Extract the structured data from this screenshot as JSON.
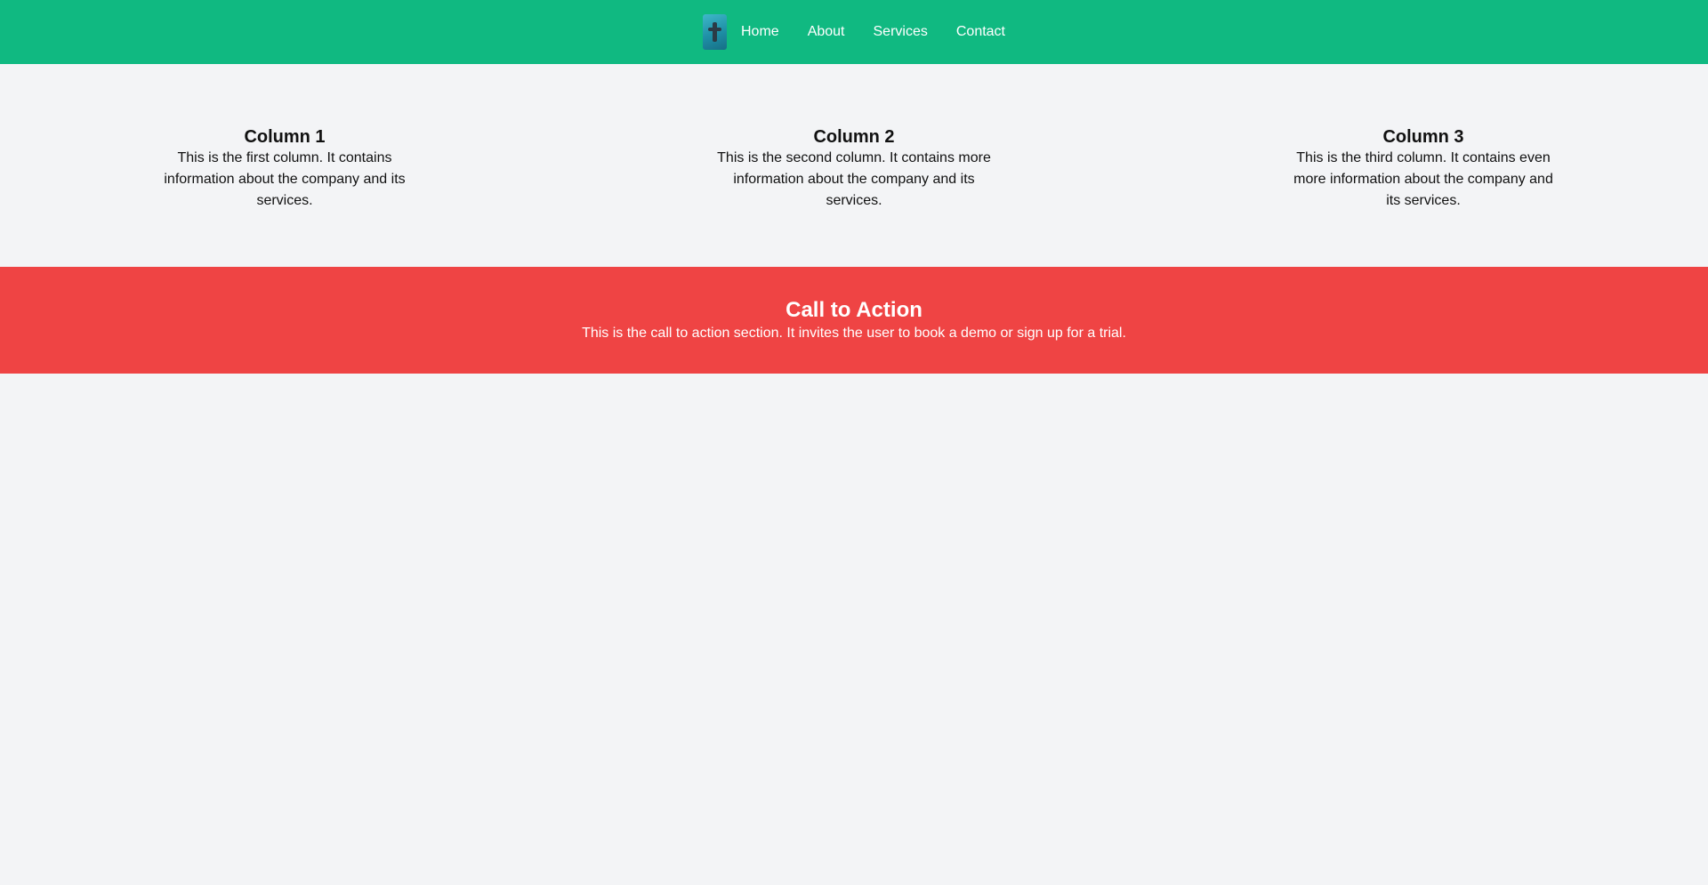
{
  "navbar": {
    "logo_icon": "logo-icon",
    "links": [
      "Home",
      "About",
      "Services",
      "Contact"
    ],
    "background": "#10b981"
  },
  "columns": [
    {
      "title": "Column 1",
      "text": "This is the first column. It contains information about the company and its services."
    },
    {
      "title": "Column 2",
      "text": "This is the second column. It contains more information about the company and its services."
    },
    {
      "title": "Column 3",
      "text": "This is the third column. It contains even more information about the company and its services."
    }
  ],
  "cta": {
    "title": "Call to Action",
    "text": "This is the call to action section. It invites the user to book a demo or sign up for a trial.",
    "background": "#ef4444"
  },
  "page": {
    "background": "#f3f4f6"
  }
}
